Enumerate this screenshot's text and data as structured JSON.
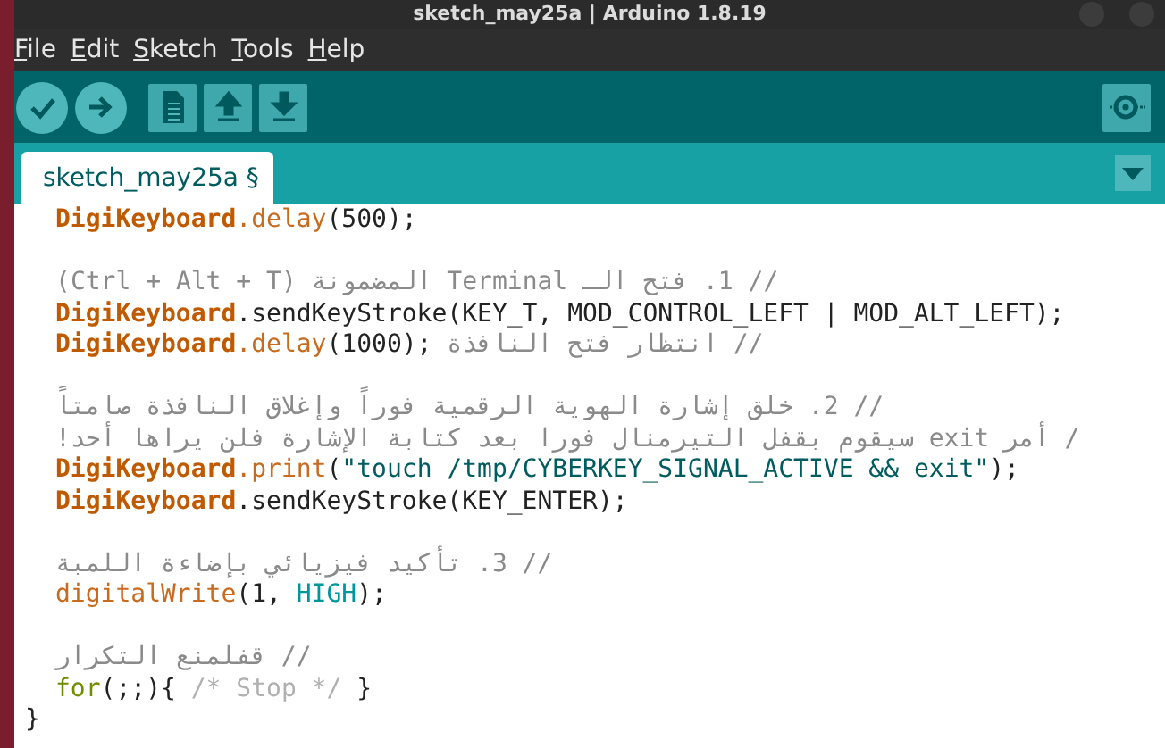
{
  "window": {
    "title": "sketch_may25a | Arduino 1.8.19"
  },
  "menu": [
    "File",
    "Edit",
    "Sketch",
    "Tools",
    "Help"
  ],
  "toolbar": [
    {
      "kind": "verify"
    },
    {
      "kind": "upload"
    },
    {
      "kind": "new"
    },
    {
      "kind": "open"
    },
    {
      "kind": "save"
    }
  ],
  "tabs": [
    {
      "label": "sketch_may25a §",
      "selected": true
    }
  ],
  "editor": {
    "lines": [
      {
        "kind": "code",
        "tokens": [
          {
            "kind": "class",
            "text": "DigiKeyboard"
          },
          {
            "kind": "function",
            "text": ".delay"
          },
          {
            "kind": "plain",
            "text": "(500);"
          }
        ]
      },
      {
        "kind": "blank"
      },
      {
        "kind": "code",
        "tokens": [
          {
            "kind": "comment",
            "text": "// 1. فتح الـ Terminal المضمونة (Ctrl + Alt + T)"
          }
        ]
      },
      {
        "kind": "code",
        "tokens": [
          {
            "kind": "class",
            "text": "DigiKeyboard"
          },
          {
            "kind": "plain",
            "text": ".sendKeyStroke(KEY_T, MOD_CONTROL_LEFT | MOD_ALT_LEFT);"
          }
        ]
      },
      {
        "kind": "code",
        "tokens": [
          {
            "kind": "class",
            "text": "DigiKeyboard"
          },
          {
            "kind": "function",
            "text": ".delay"
          },
          {
            "kind": "plain",
            "text": "(1000); "
          },
          {
            "kind": "comment",
            "text": "// انتظار فتح النافذة"
          }
        ]
      },
      {
        "kind": "blank"
      },
      {
        "kind": "code",
        "tokens": [
          {
            "kind": "comment",
            "text": "// 2. خلق إشارة الهوية الرقمية فوراً وإغلاق النافذة صامتاً"
          }
        ]
      },
      {
        "kind": "code",
        "tokens": [
          {
            "kind": "comment",
            "text": "/ أمر exit سيقوم بقفل التيرمنال فورا بعد كتابة الإشارة فلن يراها أحد!"
          }
        ]
      },
      {
        "kind": "code",
        "tokens": [
          {
            "kind": "class",
            "text": "DigiKeyboard"
          },
          {
            "kind": "function",
            "text": ".print"
          },
          {
            "kind": "plain",
            "text": "("
          },
          {
            "kind": "string",
            "text": "\"touch /tmp/CYBERKEY_SIGNAL_ACTIVE && exit\""
          },
          {
            "kind": "plain",
            "text": ");"
          }
        ]
      },
      {
        "kind": "code",
        "tokens": [
          {
            "kind": "class",
            "text": "DigiKeyboard"
          },
          {
            "kind": "plain",
            "text": ".sendKeyStroke(KEY_ENTER);"
          }
        ]
      },
      {
        "kind": "blank"
      },
      {
        "kind": "code",
        "tokens": [
          {
            "kind": "comment",
            "text": "// 3. تأكيد فيزيائي بإضاءة اللمبة"
          }
        ]
      },
      {
        "kind": "code",
        "tokens": [
          {
            "kind": "function",
            "text": "digitalWrite"
          },
          {
            "kind": "plain",
            "text": "(1, "
          },
          {
            "kind": "constant",
            "text": "HIGH"
          },
          {
            "kind": "plain",
            "text": ");"
          }
        ]
      },
      {
        "kind": "blank"
      },
      {
        "kind": "code",
        "tokens": [
          {
            "kind": "comment",
            "text": "// قفلمنع التكرار"
          }
        ]
      },
      {
        "kind": "code",
        "tokens": [
          {
            "kind": "keyword",
            "text": "for"
          },
          {
            "kind": "plain",
            "text": "(;;){ "
          },
          {
            "kind": "block_comment",
            "text": "/* Stop */"
          },
          {
            "kind": "plain",
            "text": " }"
          }
        ]
      }
    ],
    "closing_line": "}"
  }
}
